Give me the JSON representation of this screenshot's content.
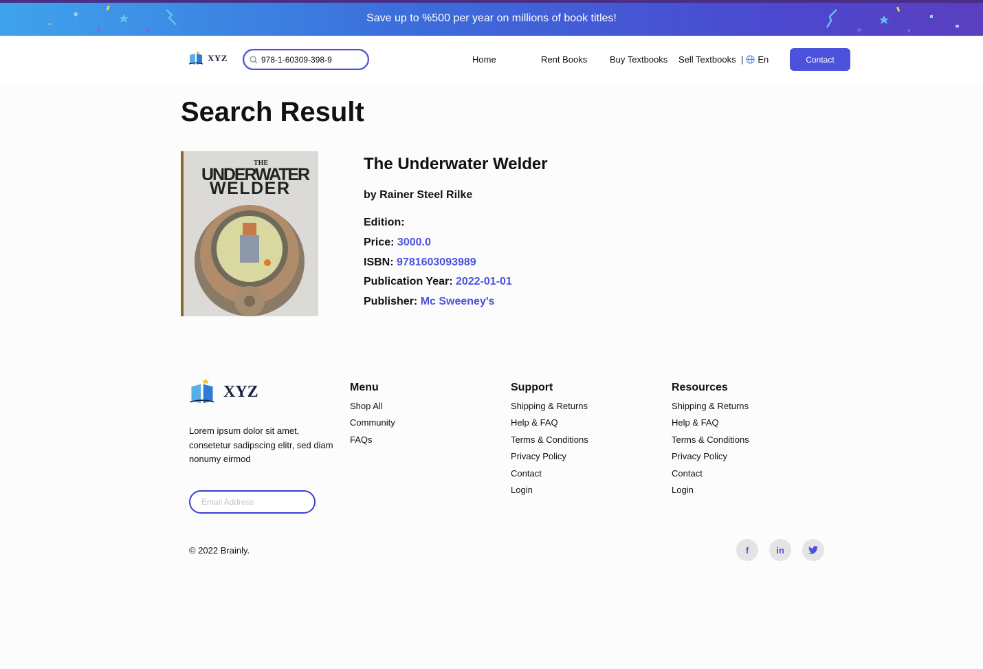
{
  "banner": {
    "text": "Save up to %500 per year on millions of book titles!"
  },
  "header": {
    "logo_text": "XYZ",
    "search": {
      "value": "978-1-60309-398-9",
      "placeholder": ""
    },
    "nav": [
      {
        "label": "Home"
      },
      {
        "label": "Rent Books"
      },
      {
        "label": "Buy Textbooks"
      },
      {
        "label": "Sell Textbooks"
      }
    ],
    "separator": "|",
    "language": "En",
    "contact_label": "Contact"
  },
  "main": {
    "title": "Search Result",
    "cover_text": {
      "line1": "THE",
      "line2": "UNDERWATER",
      "line3": "WELDER"
    },
    "book": {
      "title": "The Underwater Welder",
      "author": "by Rainer Steel Rilke",
      "edition_label": "Edition:",
      "edition_value": "",
      "price_label": "Price:",
      "price_value": "3000.0",
      "isbn_label": "ISBN:",
      "isbn_value": "9781603093989",
      "year_label": "Publication Year:",
      "year_value": "2022-01-01",
      "publisher_label": "Publisher:",
      "publisher_value": "Mc Sweeney's"
    }
  },
  "footer": {
    "logo_text": "XYZ",
    "description": "Lorem ipsum dolor sit amet, consetetur sadipscing elitr, sed diam nonumy eirmod",
    "email_placeholder": "Email Address",
    "menu": {
      "heading": "Menu",
      "links": [
        "Shop All",
        "Community",
        "FAQs"
      ]
    },
    "support": {
      "heading": "Support",
      "links": [
        "Shipping & Returns",
        "Help & FAQ",
        "Terms & Conditions",
        "Privacy Policy",
        "Contact",
        "Login"
      ]
    },
    "resources": {
      "heading": "Resources",
      "links": [
        "Shipping & Returns",
        "Help & FAQ",
        "Terms & Conditions",
        "Privacy Policy",
        "Contact",
        "Login"
      ]
    },
    "copyright": "© 2022 Brainly.",
    "social": [
      {
        "icon": "facebook-icon",
        "glyph": "f"
      },
      {
        "icon": "linkedin-icon",
        "glyph": "in"
      },
      {
        "icon": "twitter-icon",
        "glyph": "🐦"
      }
    ]
  },
  "colors": {
    "accent": "#4b52dc",
    "banner_start": "#3fa3ec",
    "banner_end": "#5b3fbf"
  }
}
